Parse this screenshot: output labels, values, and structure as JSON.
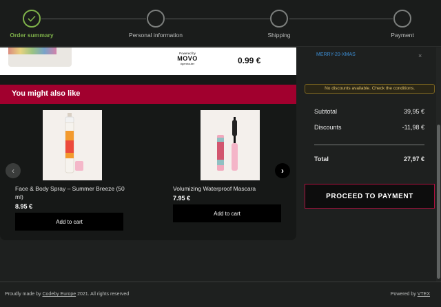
{
  "stepper": {
    "steps": [
      {
        "label": "Order summary",
        "state": "completed"
      },
      {
        "label": "Personal information",
        "state": "pending"
      },
      {
        "label": "Shipping",
        "state": "pending"
      },
      {
        "label": "Payment",
        "state": "pending"
      }
    ]
  },
  "previous_item": {
    "powered_by": "Powered by",
    "brand": "MOVO",
    "brand_sub": "#gentrouter",
    "price": "0.99 €"
  },
  "recommendations": {
    "title": "You might also like",
    "products": [
      {
        "name": "Face & Body Spray – Summer Breeze (50 ml)",
        "price": "8.95 €",
        "button": "Add to cart"
      },
      {
        "name": "Volumizing Waterproof Mascara",
        "price": "7.95 €",
        "button": "Add to cart"
      }
    ],
    "prev_glyph": "‹",
    "next_glyph": "›"
  },
  "summary": {
    "coupon_code": "MERRY-20-XMAS",
    "remove_glyph": "×",
    "notice": "No discounts available. Check the conditions.",
    "subtotal_label": "Subtotal",
    "subtotal_value": "39,95 €",
    "discounts_label": "Discounts",
    "discounts_value": "-11,98 €",
    "total_label": "Total",
    "total_value": "27,97 €",
    "proceed_label": "PROCEED TO PAYMENT"
  },
  "footer": {
    "left_prefix": "Proudly made by",
    "left_link": "Codeby Europe",
    "left_suffix": "2021. All rights reserved",
    "right_prefix": "Powered by",
    "right_link": "VTEX"
  },
  "colors": {
    "accent_green": "#7fb24a",
    "banner_red": "#a1002e",
    "proceed_border": "#b0103f",
    "coupon_blue": "#3d8fd6",
    "notice_text": "#e0c16a"
  }
}
